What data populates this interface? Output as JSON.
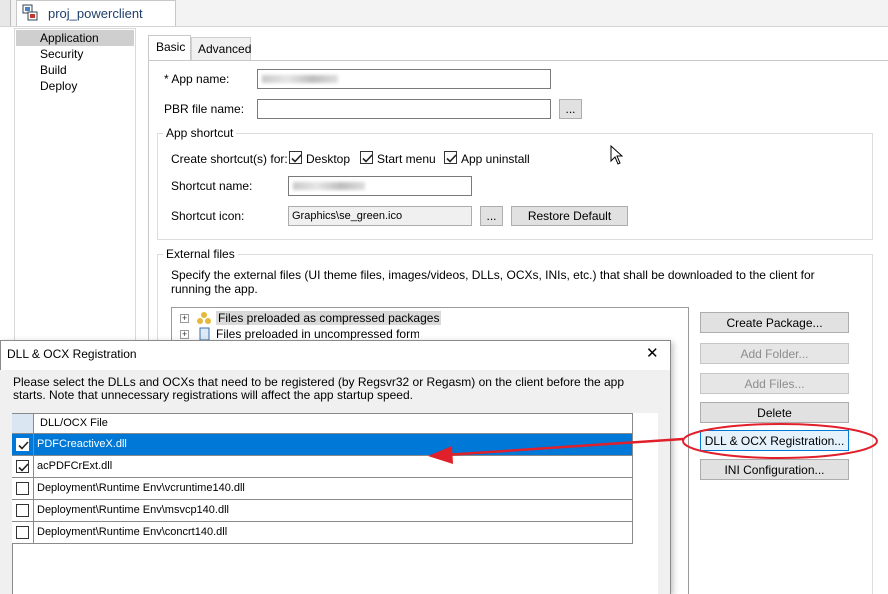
{
  "document_tab": {
    "label": "proj_powerclient"
  },
  "nav": {
    "items": [
      "Application",
      "Security",
      "Build",
      "Deploy"
    ],
    "selected": "Application"
  },
  "tabs": {
    "basic": "Basic",
    "advanced": "Advanced"
  },
  "form": {
    "app_name_label": "* App name:",
    "pbr_label": "PBR file name:",
    "browse": "...",
    "shortcut_group": "App shortcut",
    "create_shortcut_label": "Create shortcut(s) for:",
    "desktop": "Desktop",
    "start_menu": "Start menu",
    "app_uninstall": "App uninstall",
    "shortcut_name_label": "Shortcut name:",
    "shortcut_icon_label": "Shortcut icon:",
    "shortcut_icon_value": "Graphics\\se_green.ico",
    "restore_default": "Restore Default"
  },
  "external": {
    "group": "External files",
    "description": "Specify the external files (UI theme files, images/videos, DLLs, OCXs, INIs, etc.) that shall be downloaded to the client for running the app.",
    "tree": [
      "Files preloaded as compressed packages",
      "Files preloaded in uncompressed format"
    ],
    "buttons": {
      "create_package": "Create Package...",
      "add_folder": "Add Folder...",
      "add_files": "Add Files...",
      "delete": "Delete",
      "dll_ocx": "DLL & OCX Registration...",
      "ini": "INI Configuration..."
    }
  },
  "dialog": {
    "title": "DLL & OCX Registration",
    "close": "✕",
    "instructions": "Please select the DLLs and OCXs that need to be registered (by Regsvr32 or Regasm) on the client before the app starts. Note that unnecessary registrations will affect the app startup speed.",
    "column_header": "DLL/OCX File",
    "rows": [
      {
        "file": "PDFCreactiveX.dll",
        "checked": true,
        "selected": true
      },
      {
        "file": "acPDFCrExt.dll",
        "checked": true,
        "selected": false
      },
      {
        "file": "Deployment\\Runtime Env\\vcruntime140.dll",
        "checked": false,
        "selected": false
      },
      {
        "file": "Deployment\\Runtime Env\\msvcp140.dll",
        "checked": false,
        "selected": false
      },
      {
        "file": "Deployment\\Runtime Env\\concrt140.dll",
        "checked": false,
        "selected": false
      }
    ]
  },
  "colors": {
    "selection": "#0078d7",
    "annotation": "#e0202a",
    "nav_selected": "#cfcfcf"
  }
}
